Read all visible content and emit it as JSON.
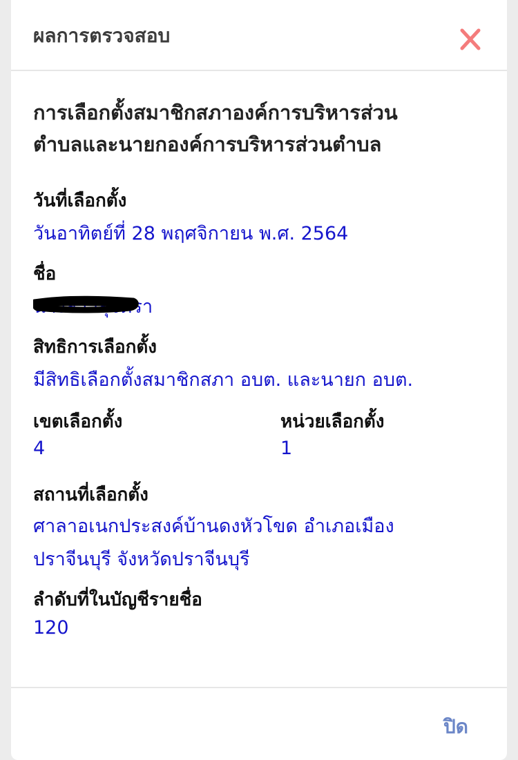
{
  "modal": {
    "title": "ผลการตรวจสอบ",
    "close_icon": "close-icon",
    "close_color": "#f47c7c"
  },
  "election": {
    "heading_line1": "การเลือกตั้งสมาชิกสภาองค์การบริหารส่วน",
    "heading_line2": "ตำบลและนายกองค์การบริหารส่วนตำบล"
  },
  "fields": {
    "date_label": "วันที่เลือกตั้ง",
    "date_value": "วันอาทิตย์ที่ 28 พฤศจิกายน พ.ศ. 2564",
    "name_label": "ชื่อ",
    "name_value": "นางสาวสุจิตรา",
    "rights_label": "สิทธิการเลือกตั้ง",
    "rights_value": "มีสิทธิเลือกตั้งสมาชิกสภา อบต. และนายก อบต.",
    "district_label": "เขตเลือกตั้ง",
    "district_value": "4",
    "unit_label": "หน่วยเลือกตั้ง",
    "unit_value": "1",
    "location_label": "สถานที่เลือกตั้ง",
    "location_line1": "ศาลาอเนกประสงค์บ้านดงหัวโขด อำเภอเมือง",
    "location_line2": "ปราจีนบุรี จังหวัดปราจีนบุรี",
    "order_label": "ลำดับที่ในบัญชีรายชื่อ",
    "order_value": "120"
  },
  "footer": {
    "close_label": "ปิด"
  },
  "colors": {
    "value_text": "#1515cc",
    "footer_link": "#6b86c7"
  }
}
